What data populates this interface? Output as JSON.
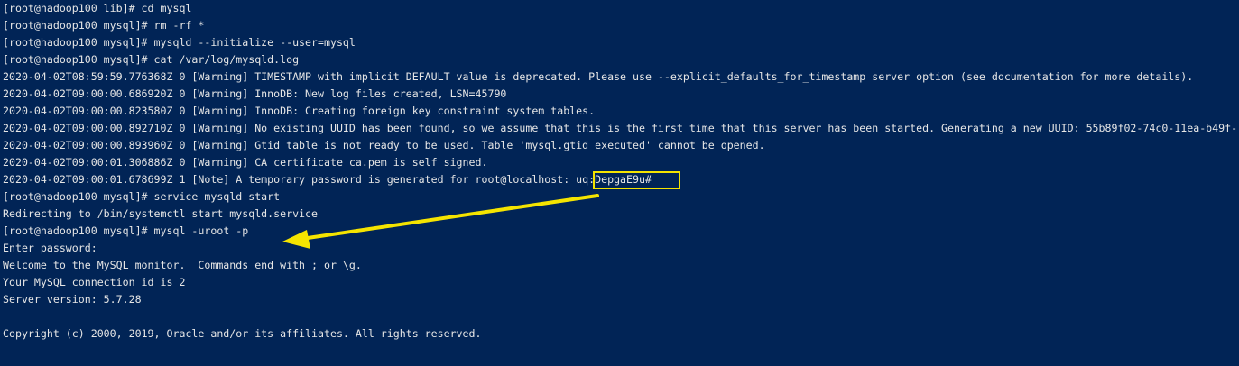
{
  "terminal": {
    "lines": [
      "[root@hadoop100 lib]# cd mysql",
      "[root@hadoop100 mysql]# rm -rf *",
      "[root@hadoop100 mysql]# mysqld --initialize --user=mysql",
      "[root@hadoop100 mysql]# cat /var/log/mysqld.log",
      "2020-04-02T08:59:59.776368Z 0 [Warning] TIMESTAMP with implicit DEFAULT value is deprecated. Please use --explicit_defaults_for_timestamp server option (see documentation for more details).",
      "2020-04-02T09:00:00.686920Z 0 [Warning] InnoDB: New log files created, LSN=45790",
      "2020-04-02T09:00:00.823580Z 0 [Warning] InnoDB: Creating foreign key constraint system tables.",
      "2020-04-02T09:00:00.892710Z 0 [Warning] No existing UUID has been found, so we assume that this is the first time that this server has been started. Generating a new UUID: 55b89f02-74c0-11ea-b49f-",
      "2020-04-02T09:00:00.893960Z 0 [Warning] Gtid table is not ready to be used. Table 'mysql.gtid_executed' cannot be opened.",
      "2020-04-02T09:00:01.306886Z 0 [Warning] CA certificate ca.pem is self signed.",
      "2020-04-02T09:00:01.678699Z 1 [Note] A temporary password is generated for root@localhost: uq:DepgaE9u#",
      "[root@hadoop100 mysql]# service mysqld start",
      "Redirecting to /bin/systemctl start mysqld.service",
      "[root@hadoop100 mysql]# mysql -uroot -p",
      "Enter password:",
      "Welcome to the MySQL monitor.  Commands end with ; or \\g.",
      "Your MySQL connection id is 2",
      "Server version: 5.7.28",
      "",
      "Copyright (c) 2000, 2019, Oracle and/or its affiliates. All rights reserved."
    ]
  },
  "annotation": {
    "highlight_color": "#f5e400",
    "arrow_color": "#f5e400"
  },
  "colors": {
    "background": "#012456",
    "text": "#e6e6e6"
  }
}
